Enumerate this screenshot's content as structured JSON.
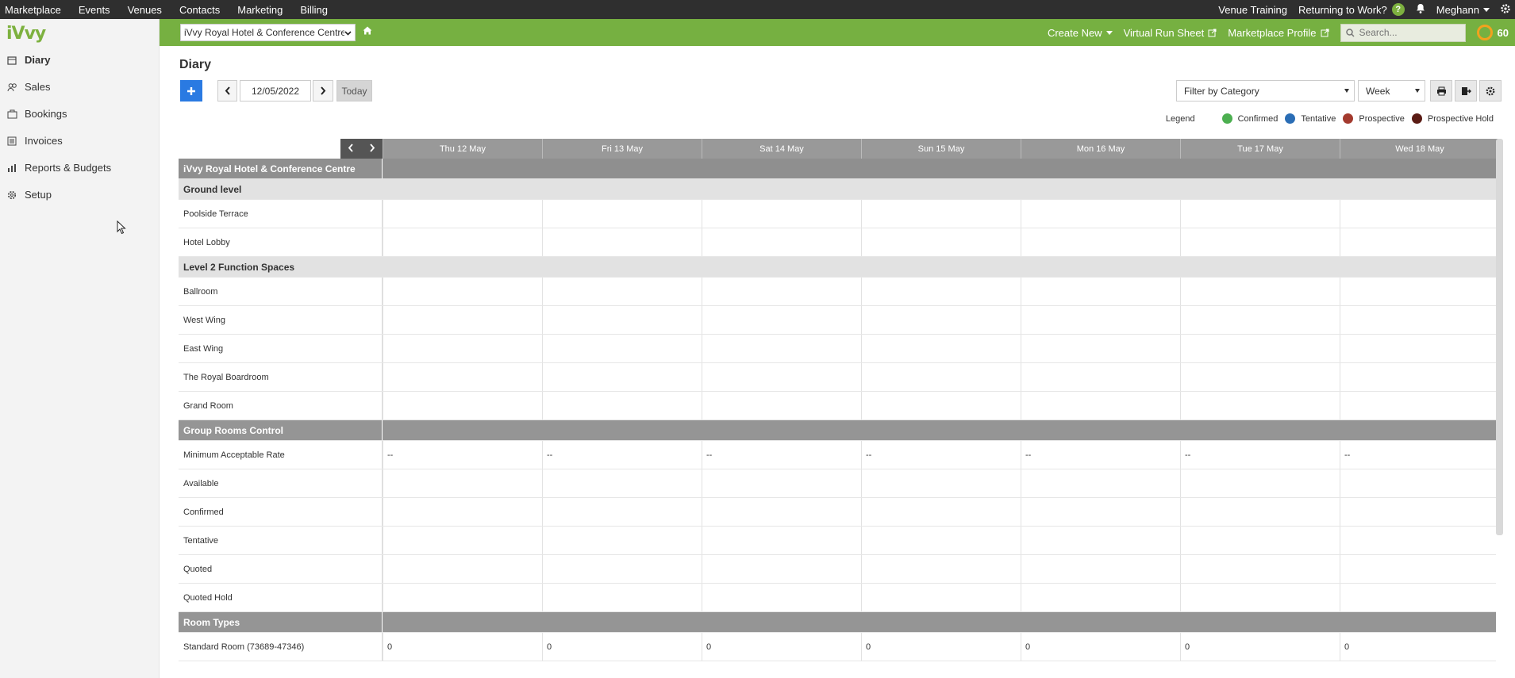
{
  "topnav": {
    "left": [
      "Marketplace",
      "Events",
      "Venues",
      "Contacts",
      "Marketing",
      "Billing"
    ],
    "venue_training": "Venue Training",
    "returning": "Returning to Work?",
    "help_glyph": "?",
    "user": "Meghann"
  },
  "sidebar": {
    "logo": "iVvy",
    "items": [
      {
        "label": "Diary",
        "icon": "calendar-icon"
      },
      {
        "label": "Sales",
        "icon": "people-icon"
      },
      {
        "label": "Bookings",
        "icon": "briefcase-icon"
      },
      {
        "label": "Invoices",
        "icon": "invoice-icon"
      },
      {
        "label": "Reports & Budgets",
        "icon": "bar-chart-icon"
      },
      {
        "label": "Setup",
        "icon": "gear-icon"
      }
    ]
  },
  "greenbar": {
    "venue": "iVvy Royal Hotel & Conference Centre",
    "create_new": "Create New",
    "virtual_run_sheet": "Virtual Run Sheet",
    "marketplace_profile": "Marketplace Profile",
    "search_placeholder": "Search...",
    "score": "60"
  },
  "main": {
    "title": "Diary",
    "date": "12/05/2022",
    "today": "Today",
    "filter": "Filter by Category",
    "view": "Week"
  },
  "legend": {
    "title": "Legend",
    "items": [
      {
        "label": "Confirmed",
        "color": "#4caf50"
      },
      {
        "label": "Tentative",
        "color": "#2a6db5"
      },
      {
        "label": "Prospective",
        "color": "#a33a2e"
      },
      {
        "label": "Prospective Hold",
        "color": "#5a1b14"
      }
    ]
  },
  "grid": {
    "days": [
      "Thu 12 May",
      "Fri 13 May",
      "Sat 14 May",
      "Sun 15 May",
      "Mon 16 May",
      "Tue 17 May",
      "Wed 18 May"
    ],
    "rows": [
      {
        "label": "iVvy Royal Hotel & Conference Centre",
        "type": "venue"
      },
      {
        "label": "Ground level",
        "type": "section"
      },
      {
        "label": "Poolside Terrace",
        "type": "space"
      },
      {
        "label": "Hotel Lobby",
        "type": "space"
      },
      {
        "label": "Level 2 Function Spaces",
        "type": "section"
      },
      {
        "label": "Ballroom",
        "type": "space"
      },
      {
        "label": "West Wing",
        "type": "space"
      },
      {
        "label": "East Wing",
        "type": "space"
      },
      {
        "label": "The Royal Boardroom",
        "type": "space"
      },
      {
        "label": "Grand Room",
        "type": "space"
      },
      {
        "label": "Group Rooms Control",
        "type": "dark"
      },
      {
        "label": "Minimum Acceptable Rate",
        "type": "value",
        "values": [
          "--",
          "--",
          "--",
          "--",
          "--",
          "--",
          "--"
        ]
      },
      {
        "label": "Available",
        "type": "space"
      },
      {
        "label": "Confirmed",
        "type": "space"
      },
      {
        "label": "Tentative",
        "type": "space"
      },
      {
        "label": "Quoted",
        "type": "space"
      },
      {
        "label": "Quoted Hold",
        "type": "space"
      },
      {
        "label": "Room Types",
        "type": "dark"
      },
      {
        "label": "Standard Room (73689-47346)",
        "type": "value",
        "values": [
          "0",
          "0",
          "0",
          "0",
          "0",
          "0",
          "0"
        ]
      }
    ]
  }
}
